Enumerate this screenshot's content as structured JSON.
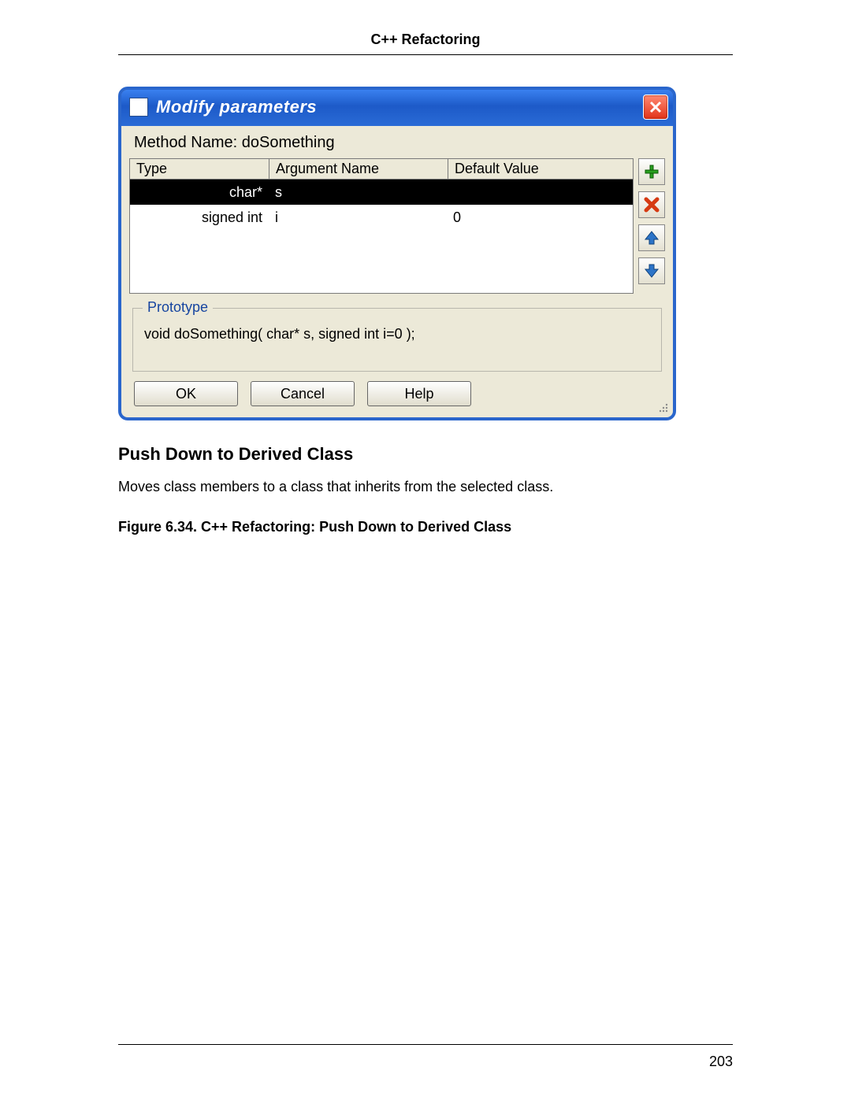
{
  "page": {
    "header_title": "C++ Refactoring",
    "page_number": "203"
  },
  "dialog": {
    "title": "Modify parameters",
    "method_name_label": "Method Name: doSomething",
    "columns": {
      "type": "Type",
      "arg": "Argument Name",
      "def": "Default Value"
    },
    "rows": [
      {
        "type": "char*",
        "arg": "s",
        "def": "",
        "selected": true
      },
      {
        "type": "signed int",
        "arg": "i",
        "def": "0",
        "selected": false
      }
    ],
    "side_buttons": {
      "add": "add",
      "remove": "remove",
      "up": "up",
      "down": "down"
    },
    "prototype": {
      "legend": "Prototype",
      "text": "void doSomething( char* s, signed int i=0 );"
    },
    "buttons": {
      "ok": "OK",
      "cancel": "Cancel",
      "help": "Help"
    }
  },
  "section": {
    "heading": "Push Down to Derived Class",
    "body": "Moves class members to a class that inherits from the selected class.",
    "figure_caption": "Figure 6.34.  C++ Refactoring: Push Down to Derived Class"
  }
}
